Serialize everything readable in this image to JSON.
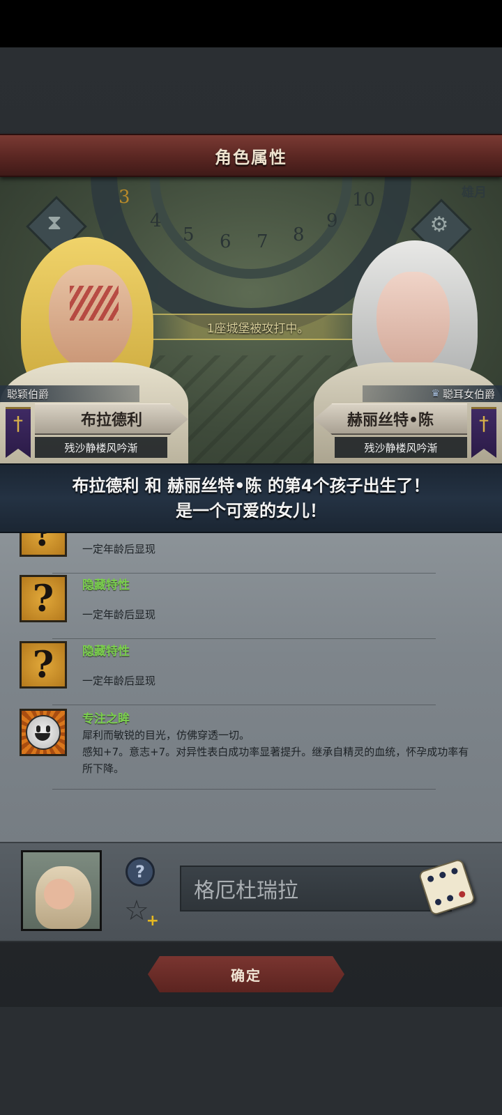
{
  "title": "角色属性",
  "map": {
    "dial_numbers": [
      "3",
      "4",
      "5",
      "6",
      "7",
      "8",
      "9",
      "10"
    ],
    "moon_label": "雄月",
    "event_text": "1座城堡被攻打中。"
  },
  "father": {
    "rank": "聪颖伯爵",
    "name": "布拉德利",
    "house": "残沙静楼风吟渐"
  },
  "mother": {
    "rank": "聪耳女伯爵",
    "name": "赫丽丝特•陈",
    "house": "残沙静楼风吟渐"
  },
  "announcement": {
    "line1": "布拉德利 和 赫丽丝特•陈 的第4个孩子出生了！",
    "line2": "是一个可爱的女儿！"
  },
  "traits": [
    {
      "name": "",
      "description": "一定年龄后显现",
      "icon": "question-icon"
    },
    {
      "name": "隐藏特性",
      "description": "一定年龄后显现",
      "icon": "question-icon"
    },
    {
      "name": "隐藏特性",
      "description": "一定年龄后显现",
      "icon": "question-icon"
    },
    {
      "name": "专注之眸",
      "description": "犀利而敏锐的目光，仿佛穿透一切。\n感知+7。意志+7。对异性表白成功率显著提升。继承自精灵的血统，怀孕成功率有所下降。",
      "icon": "smiley-icon"
    }
  ],
  "trait_icon_glyph": "?",
  "baby": {
    "name_value": "格厄杜瑞拉"
  },
  "confirm_label": "确定",
  "colors": {
    "title_bar": "#5a2622",
    "trait_green": "#7bd04e",
    "announce_bg": "#243243",
    "confirm_bg": "#6a2c27"
  }
}
